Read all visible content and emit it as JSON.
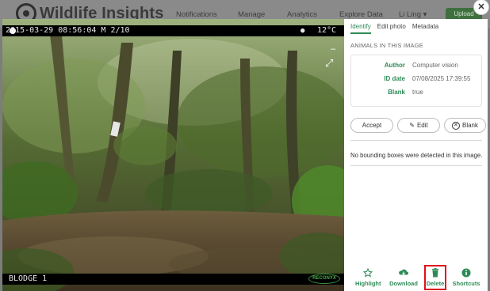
{
  "app": {
    "logo_text": "Wildlife Insights",
    "nav": [
      "Notifications",
      "Manage",
      "Analytics",
      "Explore Data",
      "Li Ling ▾"
    ],
    "upload_label": "Upload"
  },
  "photo": {
    "header_left": "2015-03-29 08:56:04    M 2/10",
    "header_right": "12°C",
    "footer_left": "BLODGE 1",
    "camera_brand": "RECONYX"
  },
  "panel": {
    "tabs": [
      "Identify",
      "Edit photo",
      "Metadata"
    ],
    "active_tab": "Identify",
    "section_title": "ANIMALS IN THIS IMAGE",
    "details": [
      {
        "key": "Author",
        "value": "Computer vision"
      },
      {
        "key": "ID date",
        "value": "07/08/2025 17:39:55"
      },
      {
        "key": "Blank",
        "value": "true"
      }
    ],
    "actions": {
      "accept": "Accept",
      "edit": "Edit",
      "blank": "Blank"
    },
    "no_bbox_message": "No bounding boxes were detected in this image.",
    "footer": {
      "highlight": "Highlight",
      "download": "Download",
      "delete": "Delete",
      "shortcuts": "Shortcuts"
    }
  },
  "colors": {
    "accent": "#2e8b57",
    "delete_highlight": "#e0101a"
  }
}
